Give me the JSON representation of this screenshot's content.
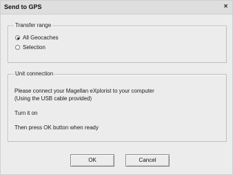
{
  "window": {
    "title": "Send to GPS",
    "close_glyph": "×"
  },
  "transfer_range": {
    "legend": "Transfer range",
    "options": [
      {
        "label": "All Geocaches",
        "selected": true
      },
      {
        "label": "Selection",
        "selected": false
      }
    ]
  },
  "unit_connection": {
    "legend": "Unit connection",
    "lines": [
      "Please connect your Magellan eXplorist to your computer",
      "(Using the USB cable provided)",
      "Turn it on",
      "Then press OK button when ready"
    ]
  },
  "buttons": {
    "ok_label": "OK",
    "cancel_label": "Cancel"
  }
}
